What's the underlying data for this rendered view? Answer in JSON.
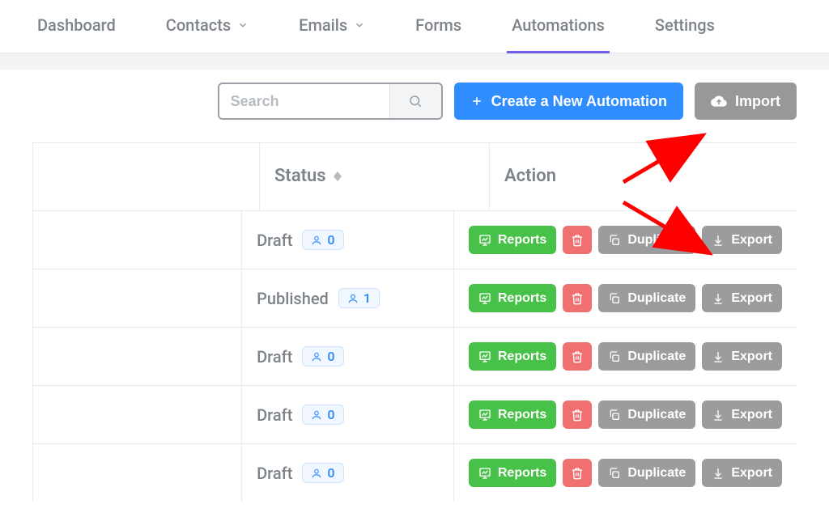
{
  "nav": {
    "items": [
      {
        "label": "Dashboard",
        "has_dropdown": false
      },
      {
        "label": "Contacts",
        "has_dropdown": true
      },
      {
        "label": "Emails",
        "has_dropdown": true
      },
      {
        "label": "Forms",
        "has_dropdown": false
      },
      {
        "label": "Automations",
        "has_dropdown": false,
        "active": true
      },
      {
        "label": "Settings",
        "has_dropdown": false
      }
    ]
  },
  "toolbar": {
    "search_placeholder": "Search",
    "create_label": "Create a New Automation",
    "import_label": "Import"
  },
  "table": {
    "headers": {
      "status": "Status",
      "action": "Action"
    },
    "actions": {
      "reports": "Reports",
      "duplicate": "Duplicate",
      "export": "Export"
    },
    "rows": [
      {
        "status": "Draft",
        "count": "0"
      },
      {
        "status": "Published",
        "count": "1"
      },
      {
        "status": "Draft",
        "count": "0"
      },
      {
        "status": "Draft",
        "count": "0"
      },
      {
        "status": "Draft",
        "count": "0"
      }
    ]
  }
}
